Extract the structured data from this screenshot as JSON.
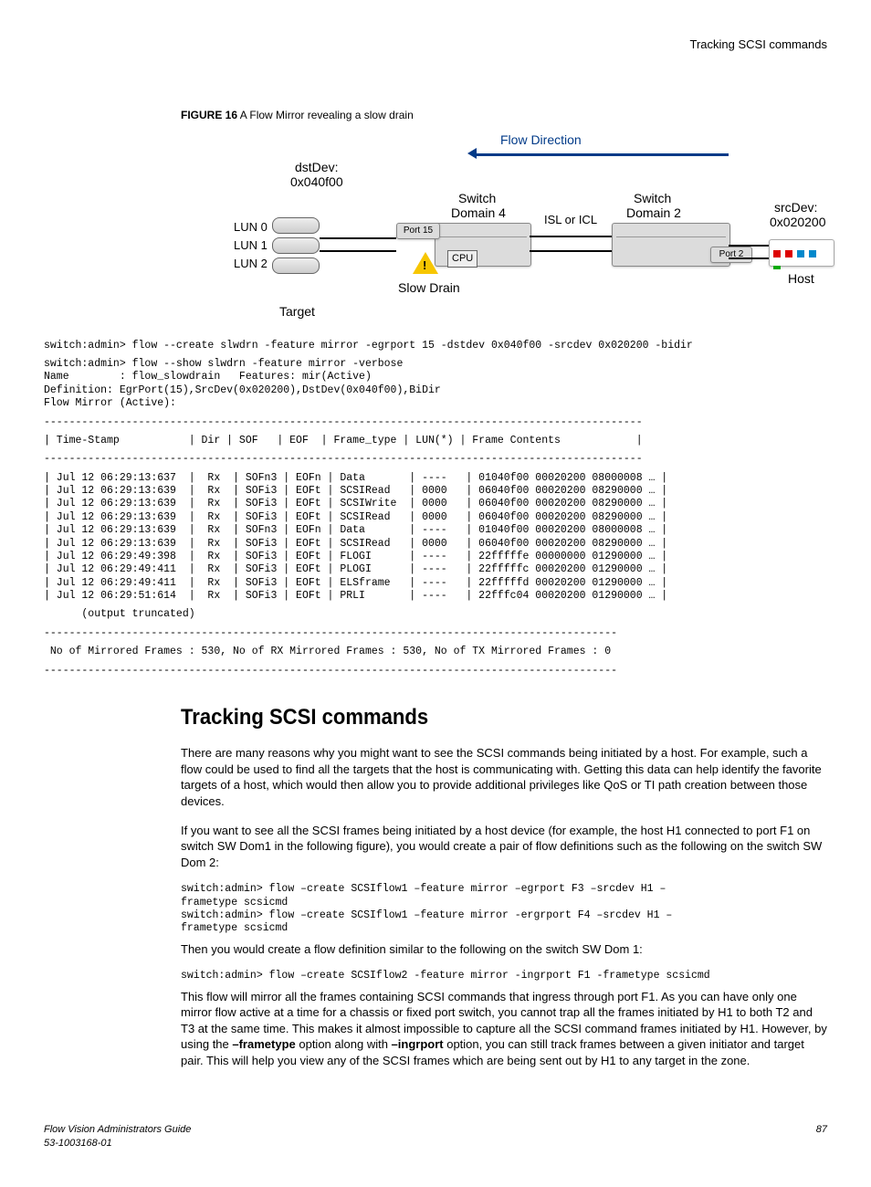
{
  "header": {
    "right": "Tracking SCSI commands"
  },
  "figure": {
    "label": "FIGURE 16",
    "caption": "A Flow Mirror revealing a slow drain"
  },
  "diagram": {
    "flow_direction": "Flow Direction",
    "dstdev_label": "dstDev:",
    "dstdev_value": "0x040f00",
    "srcdev_label": "srcDev:",
    "srcdev_value": "0x020200",
    "switch_d4_a": "Switch",
    "switch_d4_b": "Domain 4",
    "switch_d2_a": "Switch",
    "switch_d2_b": "Domain 2",
    "isl": "ISL or ICL",
    "lun0": "LUN 0",
    "lun1": "LUN 1",
    "lun2": "LUN 2",
    "port15": "Port 15",
    "port2": "Port 2",
    "cpu": "CPU",
    "slow_drain": "Slow Drain",
    "target": "Target",
    "host": "Host"
  },
  "cli_create": "switch:admin> flow --create slwdrn -feature mirror -egrport 15 -dstdev 0x040f00 -srcdev 0x020200 -bidir",
  "cli_show_header": "switch:admin> flow --show slwdrn -feature mirror -verbose\nName        : flow_slowdrain   Features: mir(Active)\nDefinition: EgrPort(15),SrcDev(0x020200),DstDev(0x040f00),BiDir\nFlow Mirror (Active):",
  "table_divider": "-----------------------------------------------------------------------------------------------",
  "table_header": "| Time-Stamp           | Dir | SOF   | EOF  | Frame_type | LUN(*) | Frame Contents            |",
  "table_rows": [
    "| Jul 12 06:29:13:637  |  Rx  | SOFn3 | EOFn | Data       | ----   | 01040f00 00020200 08000008 … |",
    "| Jul 12 06:29:13:639  |  Rx  | SOFi3 | EOFt | SCSIRead   | 0000   | 06040f00 00020200 08290000 … |",
    "| Jul 12 06:29:13:639  |  Rx  | SOFi3 | EOFt | SCSIWrite  | 0000   | 06040f00 00020200 08290000 … |",
    "| Jul 12 06:29:13:639  |  Rx  | SOFi3 | EOFt | SCSIRead   | 0000   | 06040f00 00020200 08290000 … |",
    "| Jul 12 06:29:13:639  |  Rx  | SOFn3 | EOFn | Data       | ----   | 01040f00 00020200 08000008 … |",
    "| Jul 12 06:29:13:639  |  Rx  | SOFi3 | EOFt | SCSIRead   | 0000   | 06040f00 00020200 08290000 … |",
    "| Jul 12 06:29:49:398  |  Rx  | SOFi3 | EOFt | FLOGI      | ----   | 22fffffe 00000000 01290000 … |",
    "| Jul 12 06:29:49:411  |  Rx  | SOFi3 | EOFt | PLOGI      | ----   | 22fffffc 00020200 01290000 … |",
    "| Jul 12 06:29:49:411  |  Rx  | SOFi3 | EOFt | ELSframe   | ----   | 22fffffd 00020200 01290000 … |",
    "| Jul 12 06:29:51:614  |  Rx  | SOFi3 | EOFt | PRLI       | ----   | 22fffc04 00020200 01290000 … |"
  ],
  "table_trunc": "      (output truncated)",
  "table_footer_div": "-------------------------------------------------------------------------------------------",
  "table_summary": " No of Mirrored Frames : 530, No of RX Mirrored Frames : 530, No of TX Mirrored Frames : 0",
  "section_title": "Tracking SCSI commands",
  "para1": "There are many reasons why you might want to see the SCSI commands being initiated by a host. For example, such a flow could be used to find all the targets that the host is communicating with. Getting this data can help identify the favorite targets of a host, which would then allow you to provide additional privileges like QoS or TI path creation between those devices.",
  "para2": "If you want to see all the SCSI frames being initiated by a host device (for example, the host H1 connected to port F1 on switch SW Dom1 in the following figure), you would create a pair of flow definitions such as the following on the switch SW Dom 2:",
  "cli_block2": "switch:admin> flow –create SCSIflow1 –feature mirror –egrport F3 –srcdev H1 –\nframetype scsicmd\nswitch:admin> flow –create SCSIflow1 –feature mirror -ergrport F4 –srcdev H1 –\nframetype scsicmd",
  "para3": "Then you would create a flow definition similar to the following on the switch SW Dom 1:",
  "cli_block3": "switch:admin> flow –create SCSIflow2 -feature mirror -ingrport F1 -frametype scsicmd",
  "para4_pre": "This flow will mirror all the frames containing SCSI commands that ingress through port F1. As you can have only one mirror flow active at a time for a chassis or fixed port switch, you cannot trap all the frames initiated by H1 to both T2 and T3 at the same time. This makes it almost impossible to capture all the SCSI command frames initiated by H1. However, by using the ",
  "para4_b1": "–frametype",
  "para4_mid": " option along with ",
  "para4_b2": "–ingrport",
  "para4_post": " option, you can still track frames between a given initiator and target pair. This will help you view any of the SCSI frames which are being sent out by H1 to any target in the zone.",
  "footer": {
    "left1": "Flow Vision Administrators Guide",
    "left2": "53-1003168-01",
    "right": "87"
  }
}
